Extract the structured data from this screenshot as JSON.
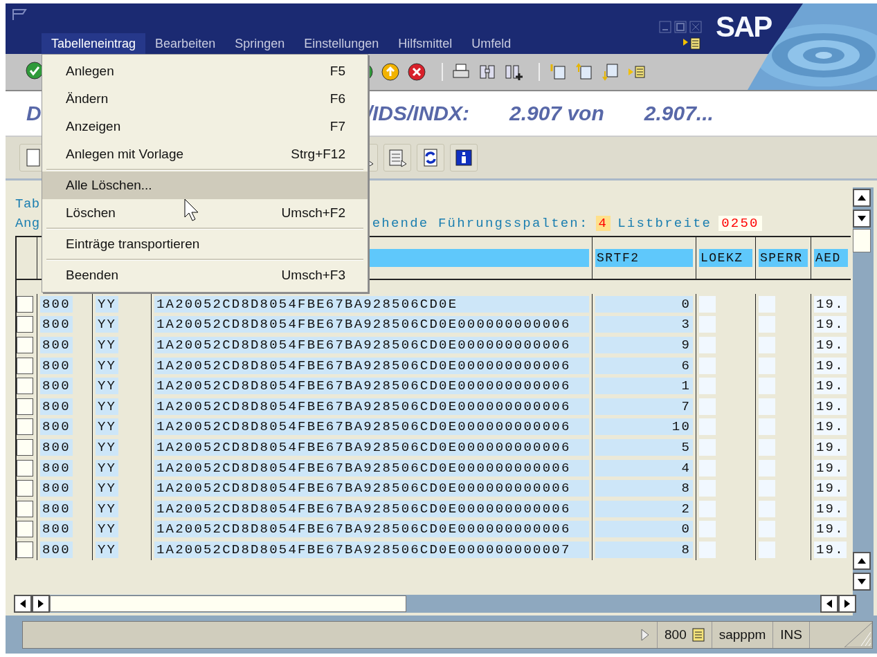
{
  "window": {
    "logo": "SAP"
  },
  "menu_bar": [
    {
      "label": "Tabelleneintrag",
      "selected": true
    },
    {
      "label": "Bearbeiten",
      "selected": false
    },
    {
      "label": "Springen",
      "selected": false
    },
    {
      "label": "Einstellungen",
      "selected": false
    },
    {
      "label": "Hilfsmittel",
      "selected": false
    },
    {
      "label": "Umfeld",
      "selected": false
    }
  ],
  "menu": [
    {
      "kind": "item",
      "label": "Anlegen",
      "shortcut": "F5",
      "selected": false
    },
    {
      "kind": "item",
      "label": "Ändern",
      "shortcut": "F6",
      "selected": false
    },
    {
      "kind": "item",
      "label": "Anzeigen",
      "shortcut": "F7",
      "selected": false
    },
    {
      "kind": "item",
      "label": "Anlegen mit Vorlage",
      "shortcut": "Strg+F12",
      "selected": false
    },
    {
      "kind": "separator"
    },
    {
      "kind": "item",
      "label": "Alle Löschen...",
      "selected": true
    },
    {
      "kind": "item",
      "label": "Löschen",
      "shortcut": "Umsch+F2",
      "selected": false
    },
    {
      "kind": "separator"
    },
    {
      "kind": "item",
      "label": "Einträge transportieren",
      "selected": false
    },
    {
      "kind": "separator"
    },
    {
      "kind": "item",
      "label": "Beenden",
      "shortcut": "Umsch+F3",
      "selected": false
    }
  ],
  "title": {
    "left": "D",
    "parts": [
      "/IDS/INDX:",
      "2.907 von",
      "2.907..."
    ]
  },
  "info": {
    "line1": "Tab",
    "line2_left": "Ang",
    "line2_right": "ehende Führungsspalten:",
    "lead_columns": "4",
    "width_label": "Listbreite",
    "width_value": "0250"
  },
  "table": {
    "columns": [
      "",
      "",
      "",
      "SRTF2",
      "LOEKZ",
      "SPERR",
      "AED"
    ],
    "rows": [
      {
        "selected": false,
        "cells": [
          "800",
          "YY",
          "1A20052CD8D8054FBE67BA928506CD0E",
          "0",
          "",
          "",
          "19."
        ]
      },
      {
        "selected": false,
        "cells": [
          "800",
          "YY",
          "1A20052CD8D8054FBE67BA928506CD0E000000000006",
          "3",
          "",
          "",
          "19."
        ]
      },
      {
        "selected": false,
        "cells": [
          "800",
          "YY",
          "1A20052CD8D8054FBE67BA928506CD0E000000000006",
          "9",
          "",
          "",
          "19."
        ]
      },
      {
        "selected": false,
        "cells": [
          "800",
          "YY",
          "1A20052CD8D8054FBE67BA928506CD0E000000000006",
          "6",
          "",
          "",
          "19."
        ]
      },
      {
        "selected": false,
        "cells": [
          "800",
          "YY",
          "1A20052CD8D8054FBE67BA928506CD0E000000000006",
          "1",
          "",
          "",
          "19."
        ]
      },
      {
        "selected": false,
        "cells": [
          "800",
          "YY",
          "1A20052CD8D8054FBE67BA928506CD0E000000000006",
          "7",
          "",
          "",
          "19."
        ]
      },
      {
        "selected": false,
        "cells": [
          "800",
          "YY",
          "1A20052CD8D8054FBE67BA928506CD0E000000000006",
          "10",
          "",
          "",
          "19."
        ]
      },
      {
        "selected": false,
        "cells": [
          "800",
          "YY",
          "1A20052CD8D8054FBE67BA928506CD0E000000000006",
          "5",
          "",
          "",
          "19."
        ]
      },
      {
        "selected": false,
        "cells": [
          "800",
          "YY",
          "1A20052CD8D8054FBE67BA928506CD0E000000000006",
          "4",
          "",
          "",
          "19."
        ]
      },
      {
        "selected": false,
        "cells": [
          "800",
          "YY",
          "1A20052CD8D8054FBE67BA928506CD0E000000000006",
          "8",
          "",
          "",
          "19."
        ]
      },
      {
        "selected": false,
        "cells": [
          "800",
          "YY",
          "1A20052CD8D8054FBE67BA928506CD0E000000000006",
          "2",
          "",
          "",
          "19."
        ]
      },
      {
        "selected": false,
        "cells": [
          "800",
          "YY",
          "1A20052CD8D8054FBE67BA928506CD0E000000000006",
          "0",
          "",
          "",
          "19."
        ]
      },
      {
        "selected": false,
        "cells": [
          "800",
          "YY",
          "1A20052CD8D8054FBE67BA928506CD0E000000000007",
          "8",
          "",
          "",
          "19."
        ]
      }
    ]
  },
  "status_bar": {
    "system": "800",
    "user": "sapppm",
    "mode": "INS"
  }
}
